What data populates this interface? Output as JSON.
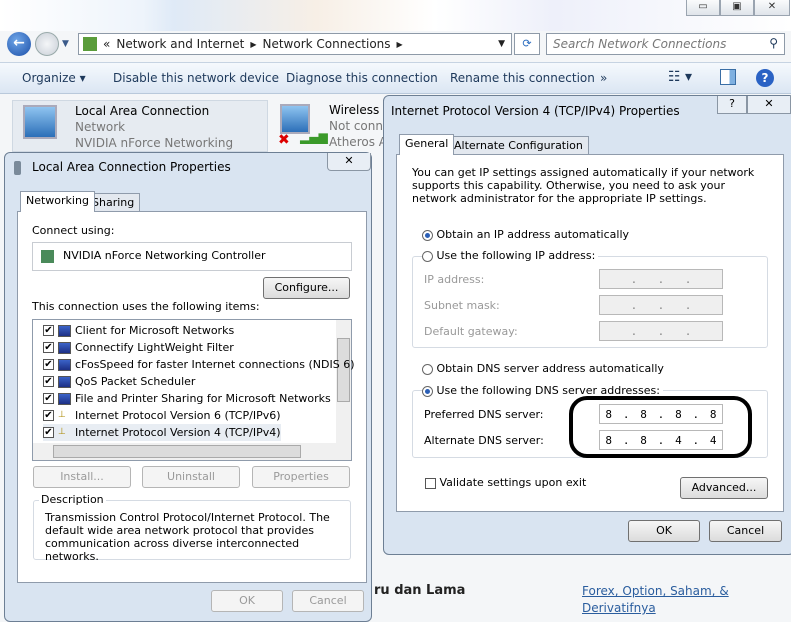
{
  "explorer": {
    "window_controls": {
      "minimize": "minimize-icon",
      "maximize": "maximize-icon",
      "close": "close-icon"
    },
    "breadcrumb": [
      "Network and Internet",
      "Network Connections"
    ],
    "breadcrumb_prefix": "«",
    "search_placeholder": "Search Network Connections",
    "toolbar": {
      "organize": "Organize ▾",
      "disable": "Disable this network device",
      "diagnose": "Diagnose this connection",
      "rename": "Rename this connection",
      "more": "»"
    },
    "connections": [
      {
        "name": "Local Area Connection",
        "status": "Network",
        "device": "NVIDIA nForce Networking Contr..."
      },
      {
        "name": "Wireless N",
        "status": "Not conne",
        "device": "Atheros Al"
      }
    ]
  },
  "lan_dialog": {
    "title": "Local Area Connection Properties",
    "tabs": [
      "Networking",
      "Sharing"
    ],
    "connect_using_label": "Connect using:",
    "adapter": "NVIDIA nForce Networking Controller",
    "configure": "Configure...",
    "items_label": "This connection uses the following items:",
    "items": [
      {
        "label": "Client for Microsoft Networks",
        "checked": true
      },
      {
        "label": "Connectify LightWeight Filter",
        "checked": true
      },
      {
        "label": "cFosSpeed for faster Internet connections (NDIS 6)",
        "checked": true
      },
      {
        "label": "QoS Packet Scheduler",
        "checked": true
      },
      {
        "label": "File and Printer Sharing for Microsoft Networks",
        "checked": true
      },
      {
        "label": "Internet Protocol Version 6 (TCP/IPv6)",
        "checked": true
      },
      {
        "label": "Internet Protocol Version 4 (TCP/IPv4)",
        "checked": true
      }
    ],
    "install": "Install...",
    "uninstall": "Uninstall",
    "properties": "Properties",
    "description_label": "Description",
    "description": "Transmission Control Protocol/Internet Protocol. The default wide area network protocol that provides communication across diverse interconnected networks.",
    "ok": "OK",
    "cancel": "Cancel"
  },
  "ipv4_dialog": {
    "title": "Internet Protocol Version 4 (TCP/IPv4) Properties",
    "help": "?",
    "tabs": [
      "General",
      "Alternate Configuration"
    ],
    "intro": "You can get IP settings assigned automatically if your network supports this capability. Otherwise, you need to ask your network administrator for the appropriate IP settings.",
    "obtain_ip": "Obtain an IP address automatically",
    "use_ip": "Use the following IP address:",
    "ip_label": "IP address:",
    "subnet_label": "Subnet mask:",
    "gateway_label": "Default gateway:",
    "obtain_dns": "Obtain DNS server address automatically",
    "use_dns": "Use the following DNS server addresses:",
    "preferred_label": "Preferred DNS server:",
    "preferred": [
      "8",
      "8",
      "8",
      "8"
    ],
    "alternate_label": "Alternate DNS server:",
    "alternate": [
      "8",
      "8",
      "4",
      "4"
    ],
    "validate": "Validate settings upon exit",
    "advanced": "Advanced...",
    "ok": "OK",
    "cancel": "Cancel",
    "selected_ip_option": "obtain",
    "selected_dns_option": "manual"
  },
  "web_background": {
    "heading": "ru dan Lama",
    "link": "Forex, Option, Saham, & Derivatifnya"
  }
}
